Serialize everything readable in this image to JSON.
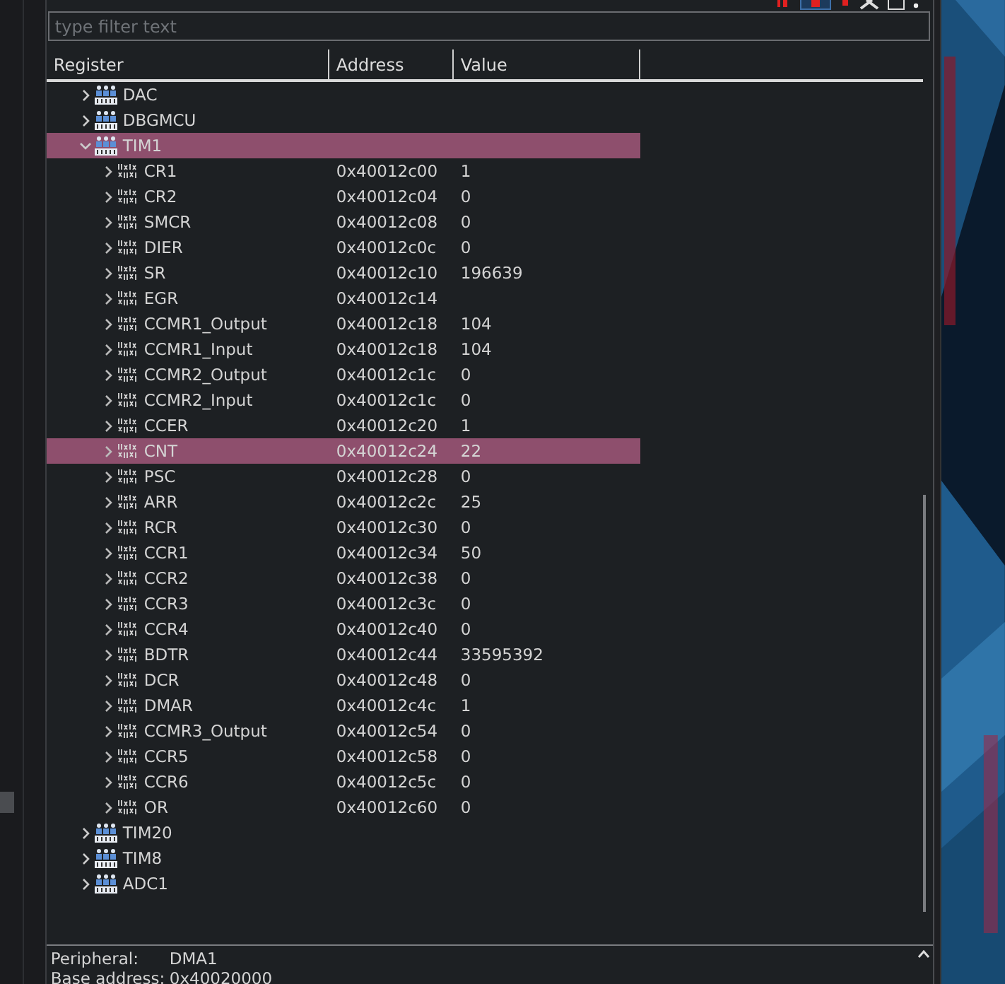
{
  "filter": {
    "placeholder": "type filter text"
  },
  "columns": [
    "Register",
    "Address",
    "Value"
  ],
  "peripherals": [
    {
      "name": "DAC",
      "expanded": false,
      "selected": false
    },
    {
      "name": "DBGMCU",
      "expanded": false,
      "selected": false
    },
    {
      "name": "TIM1",
      "expanded": true,
      "selected": true,
      "children": [
        {
          "name": "CR1",
          "address": "0x40012c00",
          "value": "1",
          "selected": false
        },
        {
          "name": "CR2",
          "address": "0x40012c04",
          "value": "0",
          "selected": false
        },
        {
          "name": "SMCR",
          "address": "0x40012c08",
          "value": "0",
          "selected": false
        },
        {
          "name": "DIER",
          "address": "0x40012c0c",
          "value": "0",
          "selected": false
        },
        {
          "name": "SR",
          "address": "0x40012c10",
          "value": "196639",
          "selected": false
        },
        {
          "name": "EGR",
          "address": "0x40012c14",
          "selected": false
        },
        {
          "name": "CCMR1_Output",
          "address": "0x40012c18",
          "value": "104",
          "selected": false
        },
        {
          "name": "CCMR1_Input",
          "address": "0x40012c18",
          "value": "104",
          "selected": false
        },
        {
          "name": "CCMR2_Output",
          "address": "0x40012c1c",
          "value": "0",
          "selected": false
        },
        {
          "name": "CCMR2_Input",
          "address": "0x40012c1c",
          "value": "0",
          "selected": false
        },
        {
          "name": "CCER",
          "address": "0x40012c20",
          "value": "1",
          "selected": false
        },
        {
          "name": "CNT",
          "address": "0x40012c24",
          "value": "22",
          "selected": true
        },
        {
          "name": "PSC",
          "address": "0x40012c28",
          "value": "0",
          "selected": false
        },
        {
          "name": "ARR",
          "address": "0x40012c2c",
          "value": "25",
          "selected": false
        },
        {
          "name": "RCR",
          "address": "0x40012c30",
          "value": "0",
          "selected": false
        },
        {
          "name": "CCR1",
          "address": "0x40012c34",
          "value": "50",
          "selected": false
        },
        {
          "name": "CCR2",
          "address": "0x40012c38",
          "value": "0",
          "selected": false
        },
        {
          "name": "CCR3",
          "address": "0x40012c3c",
          "value": "0",
          "selected": false
        },
        {
          "name": "CCR4",
          "address": "0x40012c40",
          "value": "0",
          "selected": false
        },
        {
          "name": "BDTR",
          "address": "0x40012c44",
          "value": "33595392",
          "selected": false
        },
        {
          "name": "DCR",
          "address": "0x40012c48",
          "value": "0",
          "selected": false
        },
        {
          "name": "DMAR",
          "address": "0x40012c4c",
          "value": "1",
          "selected": false
        },
        {
          "name": "CCMR3_Output",
          "address": "0x40012c54",
          "value": "0",
          "selected": false
        },
        {
          "name": "CCR5",
          "address": "0x40012c58",
          "value": "0",
          "selected": false
        },
        {
          "name": "CCR6",
          "address": "0x40012c5c",
          "value": "0",
          "selected": false
        },
        {
          "name": "OR",
          "address": "0x40012c60",
          "value": "0",
          "selected": false
        }
      ]
    },
    {
      "name": "TIM20",
      "expanded": false,
      "selected": false
    },
    {
      "name": "TIM8",
      "expanded": false,
      "selected": false
    },
    {
      "name": "ADC1",
      "expanded": false,
      "selected": false
    }
  ],
  "details": [
    {
      "label": "Peripheral:",
      "value": "DMA1"
    },
    {
      "label": "Base address:",
      "value": "0x40020000"
    }
  ]
}
